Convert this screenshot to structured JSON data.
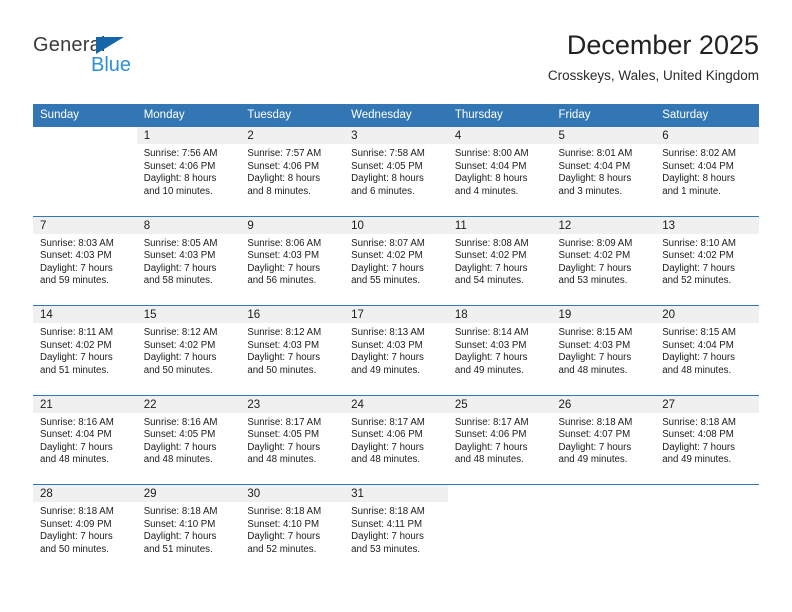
{
  "brand": {
    "name_part1": "General",
    "name_part2": "Blue",
    "triangle_icon": "triangle-icon",
    "accent_dark": "#1565a8",
    "accent_light": "#2f8fd8"
  },
  "header": {
    "title": "December 2025",
    "location": "Crosskeys, Wales, United Kingdom"
  },
  "theme": {
    "header_blue": "#3277b3",
    "daynum_band": "#f0f0f0",
    "text": "#1c1c1c"
  },
  "weekdays": [
    "Sunday",
    "Monday",
    "Tuesday",
    "Wednesday",
    "Thursday",
    "Friday",
    "Saturday"
  ],
  "labels": {
    "sunrise_prefix": "Sunrise:",
    "sunset_prefix": "Sunset:",
    "daylight_prefix": "Daylight:"
  },
  "weeks": [
    [
      {
        "day": "",
        "l1": "",
        "l2": "",
        "l3": "",
        "l4": ""
      },
      {
        "day": "1",
        "l1": "Sunrise: 7:56 AM",
        "l2": "Sunset: 4:06 PM",
        "l3": "Daylight: 8 hours",
        "l4": "and 10 minutes."
      },
      {
        "day": "2",
        "l1": "Sunrise: 7:57 AM",
        "l2": "Sunset: 4:06 PM",
        "l3": "Daylight: 8 hours",
        "l4": "and 8 minutes."
      },
      {
        "day": "3",
        "l1": "Sunrise: 7:58 AM",
        "l2": "Sunset: 4:05 PM",
        "l3": "Daylight: 8 hours",
        "l4": "and 6 minutes."
      },
      {
        "day": "4",
        "l1": "Sunrise: 8:00 AM",
        "l2": "Sunset: 4:04 PM",
        "l3": "Daylight: 8 hours",
        "l4": "and 4 minutes."
      },
      {
        "day": "5",
        "l1": "Sunrise: 8:01 AM",
        "l2": "Sunset: 4:04 PM",
        "l3": "Daylight: 8 hours",
        "l4": "and 3 minutes."
      },
      {
        "day": "6",
        "l1": "Sunrise: 8:02 AM",
        "l2": "Sunset: 4:04 PM",
        "l3": "Daylight: 8 hours",
        "l4": "and 1 minute."
      }
    ],
    [
      {
        "day": "7",
        "l1": "Sunrise: 8:03 AM",
        "l2": "Sunset: 4:03 PM",
        "l3": "Daylight: 7 hours",
        "l4": "and 59 minutes."
      },
      {
        "day": "8",
        "l1": "Sunrise: 8:05 AM",
        "l2": "Sunset: 4:03 PM",
        "l3": "Daylight: 7 hours",
        "l4": "and 58 minutes."
      },
      {
        "day": "9",
        "l1": "Sunrise: 8:06 AM",
        "l2": "Sunset: 4:03 PM",
        "l3": "Daylight: 7 hours",
        "l4": "and 56 minutes."
      },
      {
        "day": "10",
        "l1": "Sunrise: 8:07 AM",
        "l2": "Sunset: 4:02 PM",
        "l3": "Daylight: 7 hours",
        "l4": "and 55 minutes."
      },
      {
        "day": "11",
        "l1": "Sunrise: 8:08 AM",
        "l2": "Sunset: 4:02 PM",
        "l3": "Daylight: 7 hours",
        "l4": "and 54 minutes."
      },
      {
        "day": "12",
        "l1": "Sunrise: 8:09 AM",
        "l2": "Sunset: 4:02 PM",
        "l3": "Daylight: 7 hours",
        "l4": "and 53 minutes."
      },
      {
        "day": "13",
        "l1": "Sunrise: 8:10 AM",
        "l2": "Sunset: 4:02 PM",
        "l3": "Daylight: 7 hours",
        "l4": "and 52 minutes."
      }
    ],
    [
      {
        "day": "14",
        "l1": "Sunrise: 8:11 AM",
        "l2": "Sunset: 4:02 PM",
        "l3": "Daylight: 7 hours",
        "l4": "and 51 minutes."
      },
      {
        "day": "15",
        "l1": "Sunrise: 8:12 AM",
        "l2": "Sunset: 4:02 PM",
        "l3": "Daylight: 7 hours",
        "l4": "and 50 minutes."
      },
      {
        "day": "16",
        "l1": "Sunrise: 8:12 AM",
        "l2": "Sunset: 4:03 PM",
        "l3": "Daylight: 7 hours",
        "l4": "and 50 minutes."
      },
      {
        "day": "17",
        "l1": "Sunrise: 8:13 AM",
        "l2": "Sunset: 4:03 PM",
        "l3": "Daylight: 7 hours",
        "l4": "and 49 minutes."
      },
      {
        "day": "18",
        "l1": "Sunrise: 8:14 AM",
        "l2": "Sunset: 4:03 PM",
        "l3": "Daylight: 7 hours",
        "l4": "and 49 minutes."
      },
      {
        "day": "19",
        "l1": "Sunrise: 8:15 AM",
        "l2": "Sunset: 4:03 PM",
        "l3": "Daylight: 7 hours",
        "l4": "and 48 minutes."
      },
      {
        "day": "20",
        "l1": "Sunrise: 8:15 AM",
        "l2": "Sunset: 4:04 PM",
        "l3": "Daylight: 7 hours",
        "l4": "and 48 minutes."
      }
    ],
    [
      {
        "day": "21",
        "l1": "Sunrise: 8:16 AM",
        "l2": "Sunset: 4:04 PM",
        "l3": "Daylight: 7 hours",
        "l4": "and 48 minutes."
      },
      {
        "day": "22",
        "l1": "Sunrise: 8:16 AM",
        "l2": "Sunset: 4:05 PM",
        "l3": "Daylight: 7 hours",
        "l4": "and 48 minutes."
      },
      {
        "day": "23",
        "l1": "Sunrise: 8:17 AM",
        "l2": "Sunset: 4:05 PM",
        "l3": "Daylight: 7 hours",
        "l4": "and 48 minutes."
      },
      {
        "day": "24",
        "l1": "Sunrise: 8:17 AM",
        "l2": "Sunset: 4:06 PM",
        "l3": "Daylight: 7 hours",
        "l4": "and 48 minutes."
      },
      {
        "day": "25",
        "l1": "Sunrise: 8:17 AM",
        "l2": "Sunset: 4:06 PM",
        "l3": "Daylight: 7 hours",
        "l4": "and 48 minutes."
      },
      {
        "day": "26",
        "l1": "Sunrise: 8:18 AM",
        "l2": "Sunset: 4:07 PM",
        "l3": "Daylight: 7 hours",
        "l4": "and 49 minutes."
      },
      {
        "day": "27",
        "l1": "Sunrise: 8:18 AM",
        "l2": "Sunset: 4:08 PM",
        "l3": "Daylight: 7 hours",
        "l4": "and 49 minutes."
      }
    ],
    [
      {
        "day": "28",
        "l1": "Sunrise: 8:18 AM",
        "l2": "Sunset: 4:09 PM",
        "l3": "Daylight: 7 hours",
        "l4": "and 50 minutes."
      },
      {
        "day": "29",
        "l1": "Sunrise: 8:18 AM",
        "l2": "Sunset: 4:10 PM",
        "l3": "Daylight: 7 hours",
        "l4": "and 51 minutes."
      },
      {
        "day": "30",
        "l1": "Sunrise: 8:18 AM",
        "l2": "Sunset: 4:10 PM",
        "l3": "Daylight: 7 hours",
        "l4": "and 52 minutes."
      },
      {
        "day": "31",
        "l1": "Sunrise: 8:18 AM",
        "l2": "Sunset: 4:11 PM",
        "l3": "Daylight: 7 hours",
        "l4": "and 53 minutes."
      },
      {
        "day": "",
        "l1": "",
        "l2": "",
        "l3": "",
        "l4": ""
      },
      {
        "day": "",
        "l1": "",
        "l2": "",
        "l3": "",
        "l4": ""
      },
      {
        "day": "",
        "l1": "",
        "l2": "",
        "l3": "",
        "l4": ""
      }
    ]
  ]
}
